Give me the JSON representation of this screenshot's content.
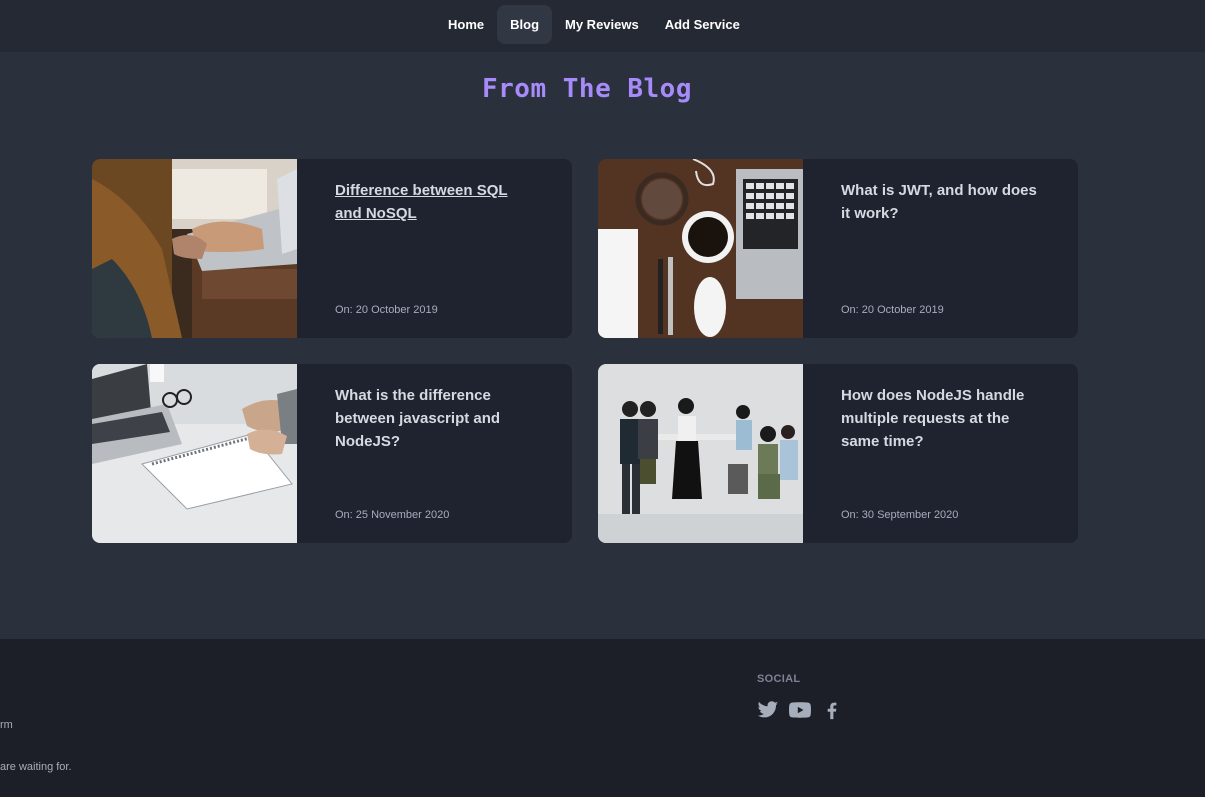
{
  "nav": {
    "items": [
      {
        "label": "Home"
      },
      {
        "label": "Blog"
      },
      {
        "label": "My Reviews"
      },
      {
        "label": "Add Service"
      }
    ]
  },
  "blog": {
    "title": "From The Blog",
    "posts": [
      {
        "title": "Difference between SQL and NoSQL",
        "date": "On: 20 October 2019",
        "image": "laptop-typing-photo"
      },
      {
        "title": "What is JWT, and how does it work?",
        "date": "On: 20 October 2019",
        "image": "desk-coffee-laptop-photo"
      },
      {
        "title": "What is the difference between javascript and NodeJS?",
        "date": "On: 25 November 2020",
        "image": "laptop-notebook-desk-photo"
      },
      {
        "title": "How does NodeJS handle multiple requests at the same time?",
        "date": "On: 30 September 2020",
        "image": "team-meeting-photo"
      }
    ]
  },
  "footer": {
    "fragment_1": "rm",
    "fragment_2": "are waiting for.",
    "social_title": "SOCIAL",
    "social_icons": [
      "twitter-icon",
      "youtube-icon",
      "facebook-icon"
    ]
  },
  "colors": {
    "background": "#2a303c",
    "navbar": "#242933",
    "card": "#1f2330",
    "footer": "#1c1f27",
    "accent": "#a78bfa"
  }
}
